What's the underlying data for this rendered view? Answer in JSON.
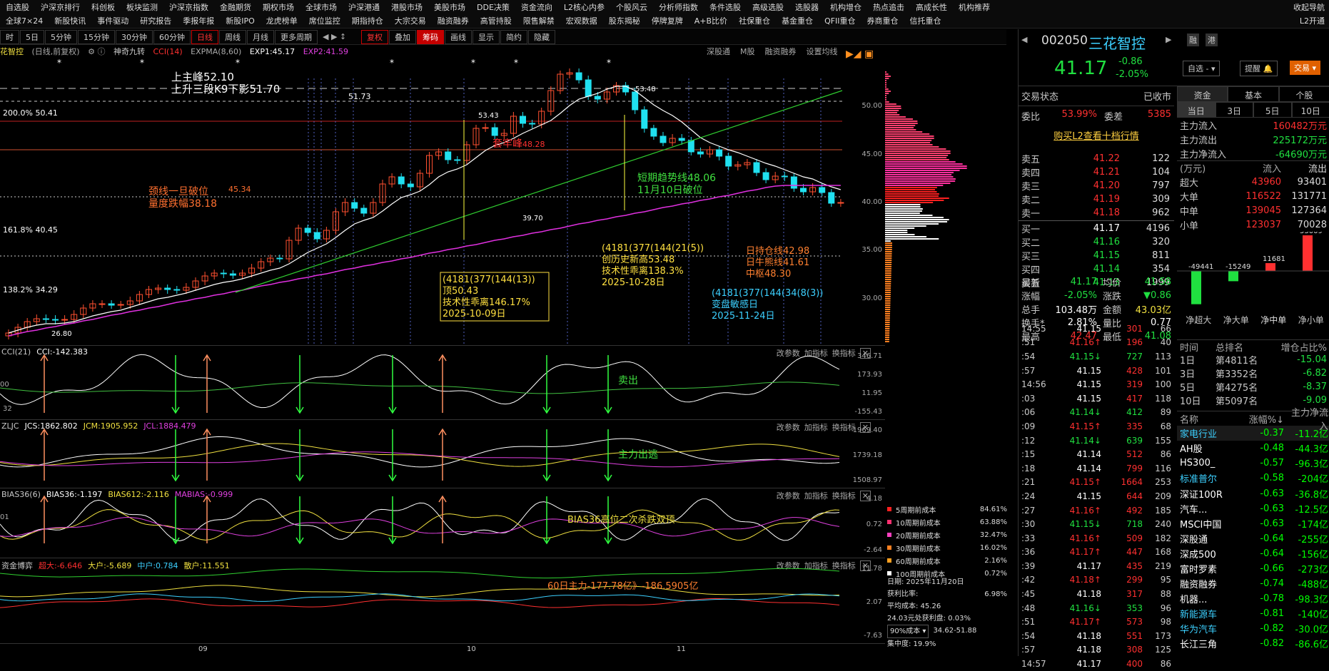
{
  "menu": {
    "row1": [
      "自选股",
      "沪深京排行",
      "科创板",
      "板块监测",
      "沪深京指数",
      "金融期货",
      "期权市场",
      "全球市场",
      "沪深港通",
      "港股市场",
      "美股市场",
      "DDE决策",
      "资金流向",
      "L2核心内参",
      "个股风云",
      "分析师指数",
      "条件选股",
      "高级选股",
      "选股器",
      "机构增仓",
      "热点追击",
      "高成长性",
      "机构推荐"
    ],
    "row2": [
      "全球7×24",
      "新股快讯",
      "事件驱动",
      "研究报告",
      "季报年报",
      "新股IPO",
      "龙虎榜单",
      "席位监控",
      "期指持仓",
      "大宗交易",
      "融资融券",
      "高管持股",
      "限售解禁",
      "宏观数据",
      "股东揭秘",
      "停牌复牌",
      "A+B比价",
      "社保重仓",
      "基金重仓",
      "QFII重仓",
      "券商重仓",
      "信托重仓"
    ],
    "right1": "收起导航",
    "right2": "L2开通"
  },
  "period": [
    "时",
    "5日",
    "5分钟",
    "15分钟",
    "30分钟",
    "60分钟",
    "日线",
    "周线",
    "月线",
    "更多周期"
  ],
  "tools": [
    "复权",
    "叠加",
    "筹码",
    "画线",
    "显示",
    "简约",
    "隐藏"
  ],
  "info": {
    "name": "花智控",
    "mode": "(日线,前复权)",
    "shenqi": "神奇九转",
    "cci": "CCI(14)",
    "expma": "EXPMA(8,60)",
    "exp1": "EXP1:45.17",
    "exp2": "EXP2:41.59",
    "right": [
      "深股通",
      "M股",
      "融资融券",
      "设置均线"
    ]
  },
  "price_axis": [
    "50.00",
    "45.00",
    "40.00",
    "35.00",
    "30.00"
  ],
  "annotations": {
    "peak": "上主峰52.10",
    "k9": "上升三段K9下影51.70",
    "fib200": "200.0% 50.41",
    "fib161": "161.8% 40.45",
    "fib138": "138.2% 34.29",
    "neck1": "颈线一旦破位",
    "neck2": "量度跌幅38.18",
    "neckval": "45.34",
    "taolao": "套牢峰",
    "v4828": "48.28",
    "v5173": "51.73",
    "v5343": "53.43",
    "v5348": "53.48",
    "v3970": "39.70",
    "v2680": "26.80",
    "trend1": "短期趋势线48.06",
    "trend2": "11月10日破位",
    "box1": [
      "(4181(377(144(13))",
      "顶50.43",
      "技术性乖离146.17%",
      "2025-10-09日"
    ],
    "box2": [
      "(4181(377(144(21(5))",
      "创历史新高53.48",
      "技术性乖离138.3%",
      "2025-10-28日"
    ],
    "box3": [
      "(4181(377(144(34(8(3))",
      "变盘敏感日",
      "2025-11-24日"
    ],
    "lines": [
      "日持仓线42.98",
      "日牛熊线41.61",
      "中枢48.30"
    ]
  },
  "cci": {
    "hd": "CCI(21)",
    "val": "CCI:-142.383",
    "axis": [
      "346.71",
      "173.93",
      "11.95",
      "-155.43"
    ],
    "lbl": "卖出",
    "left1": "00",
    "left2": "32"
  },
  "zljc": {
    "hd": "ZLJC",
    "jcs": "JCS:1862.802",
    "jcm": "JCM:1905.952",
    "jcl": "JCL:1884.479",
    "axis": [
      "1969.40",
      "1739.18",
      "1508.97"
    ],
    "lbl": "主力出逃"
  },
  "bias": {
    "hd": "BIAS36(6)",
    "b36": "BIAS36:-1.197",
    "b612": "BIAS612:-2.116",
    "mb": "MABIAS:-0.999",
    "axis": [
      "4.18",
      "0.72",
      "-2.64"
    ],
    "lbl": "BIAS36高位二次杀跌双顶",
    "left1": "01"
  },
  "zjbs": {
    "hd": "资金博弈",
    "cd": "超大:-6.646",
    "dh": "大户:-5.689",
    "zh": "中户:0.784",
    "sh": "散户:11.551",
    "axis": [
      "11.78",
      "2.07",
      "-7.63"
    ],
    "lbl": "60日主力-177.78亿》-186.5905亿"
  },
  "ind_btns": [
    "改参数",
    "加指标",
    "换指标"
  ],
  "date_axis": [
    "09",
    "10",
    "11"
  ],
  "cost_legend": [
    {
      "name": "5周期前成本",
      "pct": "84.61%",
      "color": "#ff2020"
    },
    {
      "name": "10周期前成本",
      "pct": "63.88%",
      "color": "#ff3070"
    },
    {
      "name": "20周期前成本",
      "pct": "32.47%",
      "color": "#ff40c0"
    },
    {
      "name": "30周期前成本",
      "pct": "16.02%",
      "color": "#ff8020"
    },
    {
      "name": "60周期前成本",
      "pct": "2.16%",
      "color": "#ffa020"
    },
    {
      "name": "100周期前成本",
      "pct": "0.72%",
      "color": "#ffffff"
    }
  ],
  "chip": {
    "date": "日期: 2025年11月20日",
    "profit": "获利比率:",
    "profit_v": "6.98%",
    "avg": "平均成本: 45.26",
    "cost_line": "24.03元处获利盘: 0.03%",
    "sel": "90%成本",
    "range": "34.62-51.88",
    "conc": "集中度: 19.9%"
  },
  "stock": {
    "code": "002050",
    "name": "三花智控",
    "price": "41.17",
    "chg": "-0.86",
    "pct": "-2.05%",
    "b1": "融",
    "b2": "港",
    "zixuan": "自选",
    "tixing": "提醒",
    "trade": "交易"
  },
  "status": {
    "label": "交易状态",
    "val": "已收市",
    "webi_l": "委比",
    "webi": "53.99%",
    "wc_l": "委差",
    "wc": "5385",
    "buyl2": "购买L2查看十档行情"
  },
  "asks": [
    [
      "卖五",
      "41.22",
      "122"
    ],
    [
      "卖四",
      "41.21",
      "104"
    ],
    [
      "卖三",
      "41.20",
      "797"
    ],
    [
      "卖二",
      "41.19",
      "309"
    ],
    [
      "卖一",
      "41.18",
      "962"
    ]
  ],
  "bids": [
    [
      "买一",
      "41.17",
      "4196"
    ],
    [
      "买二",
      "41.16",
      "320"
    ],
    [
      "买三",
      "41.15",
      "811"
    ],
    [
      "买四",
      "41.14",
      "354"
    ],
    [
      "买五",
      "41.13",
      "1999"
    ]
  ],
  "stats": [
    [
      "最新",
      "41.17",
      "均价",
      "41.58"
    ],
    [
      "涨幅",
      "-2.05%",
      "涨跌",
      "▼0.86"
    ],
    [
      "总手",
      "103.48万",
      "金额",
      "43.03亿"
    ],
    [
      "换手*",
      "2.81%",
      "量比",
      "0.77"
    ],
    [
      "最高",
      "42.47",
      "最低",
      "41.08"
    ]
  ],
  "ticks": [
    [
      "14:55",
      "41.15",
      "301",
      "66"
    ],
    [
      ":51",
      "41.16↑",
      "196",
      "40"
    ],
    [
      ":54",
      "41.15↓",
      "727",
      "113"
    ],
    [
      ":57",
      "41.15",
      "428",
      "101"
    ],
    [
      "14:56",
      "41.15",
      "319",
      "100"
    ],
    [
      ":03",
      "41.15",
      "417",
      "118"
    ],
    [
      ":06",
      "41.14↓",
      "412",
      "89"
    ],
    [
      ":09",
      "41.15↑",
      "335",
      "68"
    ],
    [
      ":12",
      "41.14↓",
      "639",
      "155"
    ],
    [
      ":15",
      "41.14",
      "512",
      "86"
    ],
    [
      ":18",
      "41.14",
      "799",
      "116"
    ],
    [
      ":21",
      "41.15↑",
      "1664",
      "253"
    ],
    [
      ":24",
      "41.15",
      "644",
      "209"
    ],
    [
      ":27",
      "41.16↑",
      "492",
      "185"
    ],
    [
      ":30",
      "41.15↓",
      "718",
      "240"
    ],
    [
      ":33",
      "41.16↑",
      "509",
      "182"
    ],
    [
      ":36",
      "41.17↑",
      "447",
      "168"
    ],
    [
      ":39",
      "41.17",
      "435",
      "219"
    ],
    [
      ":42",
      "41.18↑",
      "299",
      "95"
    ],
    [
      ":45",
      "41.18",
      "317",
      "88"
    ],
    [
      ":48",
      "41.16↓",
      "353",
      "96"
    ],
    [
      ":51",
      "41.17↑",
      "573",
      "98"
    ],
    [
      ":54",
      "41.18",
      "551",
      "173"
    ],
    [
      ":57",
      "41.18",
      "308",
      "125"
    ],
    [
      "14:57",
      "41.17",
      "400",
      "86"
    ]
  ],
  "fund_tabs": [
    "资金",
    "基本",
    "个股"
  ],
  "fund_sub": [
    "当日",
    "3日",
    "5日",
    "10日"
  ],
  "fund_flow": [
    [
      "主力流入",
      "160482万元"
    ],
    [
      "主力流出",
      "225172万元"
    ],
    [
      "主力净流入",
      "-64690万元"
    ]
  ],
  "fund_hdr": [
    "(万元)",
    "流入",
    "流出"
  ],
  "fund_rows": [
    [
      "超大",
      "43960",
      "93401"
    ],
    [
      "大单",
      "116522",
      "131771"
    ],
    [
      "中单",
      "139045",
      "127364"
    ],
    [
      "小单",
      "123037",
      "70028"
    ]
  ],
  "net_bars": {
    "values": [
      -49441,
      -15249,
      11681,
      53009
    ],
    "labels": [
      "净超大",
      "净大单",
      "净中单",
      "净小单"
    ]
  },
  "rank_hdr": [
    "时间",
    "总排名",
    "增仓占比%"
  ],
  "rank": [
    [
      "1日",
      "第4811名",
      "-15.04"
    ],
    [
      "3日",
      "第3352名",
      "-6.82"
    ],
    [
      "5日",
      "第4275名",
      "-8.37"
    ],
    [
      "10日",
      "第5097名",
      "-9.09"
    ]
  ],
  "sect_hdr": [
    "名称",
    "涨幅%↓",
    "主力净流入"
  ],
  "sectors": [
    [
      "家电行业",
      "-0.37",
      "-11.2亿"
    ],
    [
      "AH股",
      "-0.48",
      "-44.3亿"
    ],
    [
      "HS300_",
      "-0.57",
      "-96.3亿"
    ],
    [
      "标准普尔",
      "-0.58",
      "-204亿"
    ],
    [
      "深证100R",
      "-0.63",
      "-36.8亿"
    ],
    [
      "汽车...",
      "-0.63",
      "-12.5亿"
    ],
    [
      "MSCI中国",
      "-0.63",
      "-174亿"
    ],
    [
      "深股通",
      "-0.64",
      "-255亿"
    ],
    [
      "深成500",
      "-0.64",
      "-156亿"
    ],
    [
      "富时罗素",
      "-0.66",
      "-273亿"
    ],
    [
      "融资融券",
      "-0.74",
      "-488亿"
    ],
    [
      "机器...",
      "-0.78",
      "-98.3亿"
    ],
    [
      "新能源车",
      "-0.81",
      "-140亿"
    ],
    [
      "华为汽车",
      "-0.82",
      "-30.0亿"
    ],
    [
      "长江三角",
      "-0.82",
      "-86.6亿"
    ]
  ]
}
